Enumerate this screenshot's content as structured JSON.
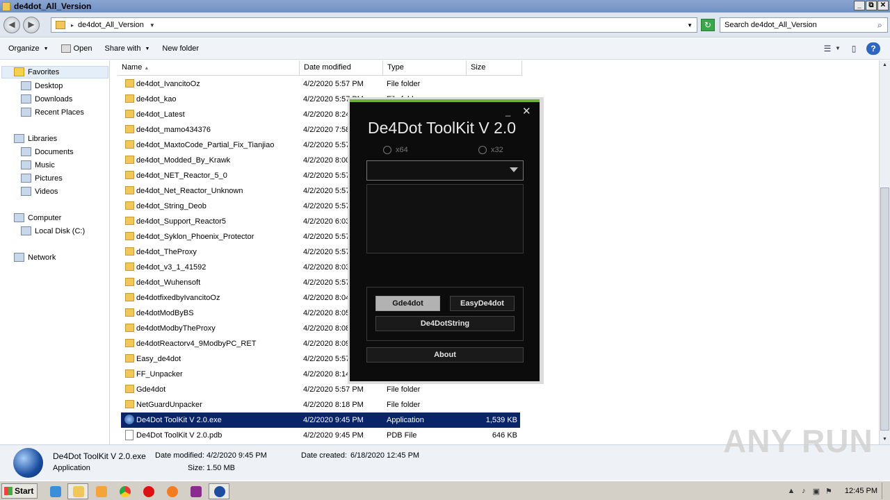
{
  "window": {
    "title": "de4dot_All_Version",
    "controls": [
      "_",
      "⧉",
      "✕"
    ]
  },
  "address": {
    "path": "de4dot_All_Version",
    "search_placeholder": "Search de4dot_All_Version"
  },
  "toolbar": {
    "organize": "Organize",
    "open": "Open",
    "share_with": "Share with",
    "new_folder": "New folder"
  },
  "nav": {
    "favorites": "Favorites",
    "desktop": "Desktop",
    "downloads": "Downloads",
    "recent_places": "Recent Places",
    "libraries": "Libraries",
    "documents": "Documents",
    "music": "Music",
    "pictures": "Pictures",
    "videos": "Videos",
    "computer": "Computer",
    "local_disk": "Local Disk (C:)",
    "network": "Network"
  },
  "columns": {
    "name": "Name",
    "date_modified": "Date modified",
    "type": "Type",
    "size": "Size"
  },
  "files": [
    {
      "name": "de4dot_IvancitoOz",
      "date": "4/2/2020 5:57 PM",
      "type": "File folder",
      "size": "",
      "icon": "folder-icon"
    },
    {
      "name": "de4dot_kao",
      "date": "4/2/2020 5:57 PM",
      "type": "File folder",
      "size": "",
      "icon": "folder-icon"
    },
    {
      "name": "de4dot_Latest",
      "date": "4/2/2020 8:24",
      "type": "",
      "size": "",
      "icon": "folder-icon"
    },
    {
      "name": "de4dot_mamo434376",
      "date": "4/2/2020 7:58",
      "type": "",
      "size": "",
      "icon": "folder-icon"
    },
    {
      "name": "de4dot_MaxtoCode_Partial_Fix_Tianjiao",
      "date": "4/2/2020 5:57",
      "type": "",
      "size": "",
      "icon": "folder-icon"
    },
    {
      "name": "de4dot_Modded_By_Krawk",
      "date": "4/2/2020 8:00",
      "type": "",
      "size": "",
      "icon": "folder-icon"
    },
    {
      "name": "de4dot_NET_Reactor_5_0",
      "date": "4/2/2020 5:57",
      "type": "",
      "size": "",
      "icon": "folder-icon"
    },
    {
      "name": "de4dot_Net_Reactor_Unknown",
      "date": "4/2/2020 5:57",
      "type": "",
      "size": "",
      "icon": "folder-icon"
    },
    {
      "name": "de4dot_String_Deob",
      "date": "4/2/2020 5:57",
      "type": "",
      "size": "",
      "icon": "folder-icon"
    },
    {
      "name": "de4dot_Support_Reactor5",
      "date": "4/2/2020 6:03",
      "type": "",
      "size": "",
      "icon": "folder-icon"
    },
    {
      "name": "de4dot_Syklon_Phoenix_Protector",
      "date": "4/2/2020 5:57",
      "type": "",
      "size": "",
      "icon": "folder-icon"
    },
    {
      "name": "de4dot_TheProxy",
      "date": "4/2/2020 5:57",
      "type": "",
      "size": "",
      "icon": "folder-icon"
    },
    {
      "name": "de4dot_v3_1_41592",
      "date": "4/2/2020 8:03",
      "type": "",
      "size": "",
      "icon": "folder-icon"
    },
    {
      "name": "de4dot_Wuhensoft",
      "date": "4/2/2020 5:57",
      "type": "",
      "size": "",
      "icon": "folder-icon"
    },
    {
      "name": "de4dotfixedbyIvancitoOz",
      "date": "4/2/2020 8:04",
      "type": "",
      "size": "",
      "icon": "folder-icon"
    },
    {
      "name": "de4dotModByBS",
      "date": "4/2/2020 8:05",
      "type": "",
      "size": "",
      "icon": "folder-icon"
    },
    {
      "name": "de4dotModbyTheProxy",
      "date": "4/2/2020 8:08",
      "type": "",
      "size": "",
      "icon": "folder-icon"
    },
    {
      "name": "de4dotReactorv4_9ModbyPC_RET",
      "date": "4/2/2020 8:09",
      "type": "",
      "size": "",
      "icon": "folder-icon"
    },
    {
      "name": "Easy_de4dot",
      "date": "4/2/2020 5:57",
      "type": "",
      "size": "",
      "icon": "folder-icon"
    },
    {
      "name": "FF_Unpacker",
      "date": "4/2/2020 8:14",
      "type": "",
      "size": "",
      "icon": "folder-icon"
    },
    {
      "name": "Gde4dot",
      "date": "4/2/2020 5:57 PM",
      "type": "File folder",
      "size": "",
      "icon": "folder-icon"
    },
    {
      "name": "NetGuardUnpacker",
      "date": "4/2/2020 8:18 PM",
      "type": "File folder",
      "size": "",
      "icon": "folder-icon"
    },
    {
      "name": "De4Dot ToolKit V 2.0.exe",
      "date": "4/2/2020 9:45 PM",
      "type": "Application",
      "size": "1,539 KB",
      "icon": "application-icon",
      "selected": true
    },
    {
      "name": "De4Dot ToolKit V 2.0.pdb",
      "date": "4/2/2020 9:45 PM",
      "type": "PDB File",
      "size": "646 KB",
      "icon": "file-icon"
    }
  ],
  "details": {
    "filename": "De4Dot ToolKit V 2.0.exe",
    "type": "Application",
    "date_modified_label": "Date modified:",
    "date_modified": "4/2/2020 9:45 PM",
    "size_label": "Size:",
    "size": "1.50 MB",
    "date_created_label": "Date created:",
    "date_created": "6/18/2020 12:45 PM"
  },
  "watermark": "ANY RUN",
  "dialog": {
    "title": "De4Dot ToolKit V 2.0",
    "minimize": "_",
    "close": "✕",
    "radio_x64": "x64",
    "radio_x32": "x32",
    "combo_value": "",
    "btn_gde4dot": "Gde4dot",
    "btn_easyde4dot": "EasyDe4dot",
    "btn_de4dotstring": "De4DotString",
    "btn_about": "About",
    "accent_color": "#6cb33e"
  },
  "taskbar": {
    "start": "Start",
    "clock": "12:45 PM"
  }
}
